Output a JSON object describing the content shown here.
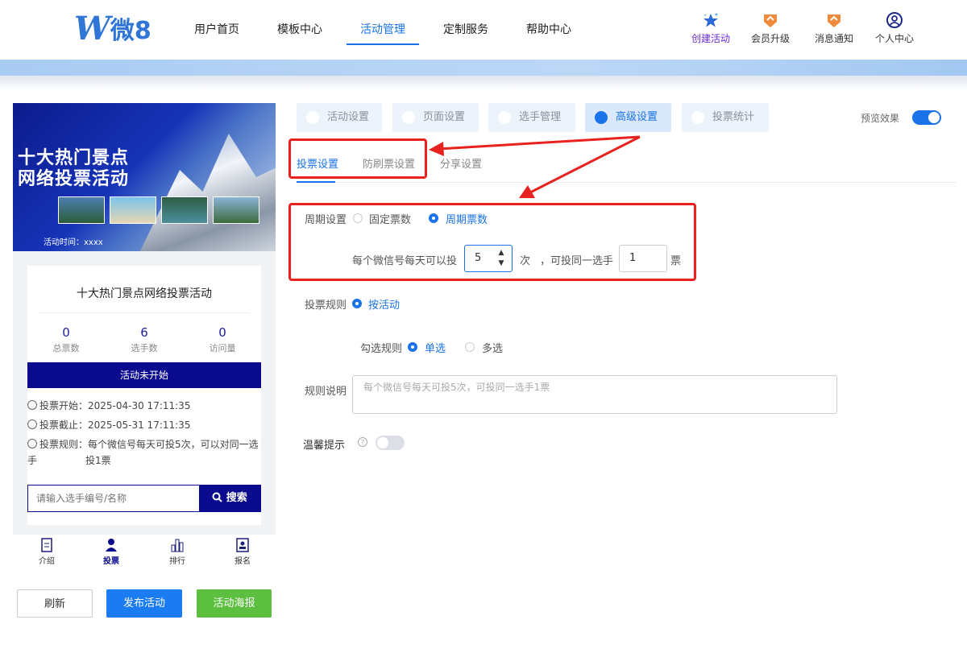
{
  "header": {
    "logo_w": "W",
    "logo_text": "微8",
    "nav": [
      "用户首页",
      "模板中心",
      "活动管理",
      "定制服务",
      "帮助中心"
    ],
    "active_nav": "活动管理",
    "actions": [
      {
        "label": "创建活动",
        "icon": "star-icon"
      },
      {
        "label": "会员升级",
        "icon": "upgrade-badge-icon"
      },
      {
        "label": "消息通知",
        "icon": "notification-badge-icon"
      },
      {
        "label": "个人中心",
        "icon": "user-icon"
      }
    ],
    "accent_color": "#1a73e8"
  },
  "preview": {
    "cover_title_line1": "十大热门景点",
    "cover_title_line2": "网络投票活动",
    "cover_time": "活动时间：xxxx",
    "card_title": "十大热门景点网络投票活动",
    "stats": [
      {
        "value": "0",
        "label": "总票数"
      },
      {
        "value": "6",
        "label": "选手数"
      },
      {
        "value": "0",
        "label": "访问量"
      }
    ],
    "status": "活动未开始",
    "vote_start": "投票开始：2025-04-30 17:11:35",
    "vote_end": "投票截止：2025-05-31 17:11:35",
    "vote_rule_line1": "投票规则：每个微信号每天可投5次，可以对同一选手",
    "vote_rule_line2": "投1票",
    "search_placeholder": "请输入选手编号/名称",
    "search_button": "搜索",
    "bottom_tabs": [
      {
        "label": "介绍",
        "icon": "document-icon"
      },
      {
        "label": "投票",
        "icon": "person-icon"
      },
      {
        "label": "排行",
        "icon": "ranking-icon"
      },
      {
        "label": "报名",
        "icon": "signup-icon"
      }
    ],
    "active_bottom_tab": "投票",
    "theme_color": "#0a0a8f"
  },
  "buttons": {
    "refresh": "刷新",
    "publish": "发布活动",
    "poster": "活动海报"
  },
  "settings": {
    "tabs": [
      "活动设置",
      "页面设置",
      "选手管理",
      "高级设置",
      "投票统计"
    ],
    "active_tab": "高级设置",
    "preview_label": "预览效果",
    "preview_on": true,
    "subtabs": [
      "投票设置",
      "防刷票设置",
      "分享设置"
    ],
    "active_subtab": "投票设置",
    "cycle_label": "周期设置",
    "cycle_options": [
      "固定票数",
      "周期票数"
    ],
    "cycle_selected": "周期票数",
    "daily_prefix": "每个微信号每天可以投",
    "daily_value": "5",
    "daily_unit": "次",
    "same_player_text": "，可投同一选手",
    "same_player_value": "1",
    "same_player_unit": "票",
    "rule_label": "投票规则",
    "rule_option": "按活动",
    "select_rule_label": "勾选规则",
    "select_options": [
      "单选",
      "多选"
    ],
    "select_selected": "单选",
    "desc_label": "规则说明",
    "desc_placeholder": "每个微信号每天可投5次，可投同一选手1票",
    "tip_label": "温馨提示",
    "tip_on": false
  },
  "annotation_color": "#e8231f"
}
